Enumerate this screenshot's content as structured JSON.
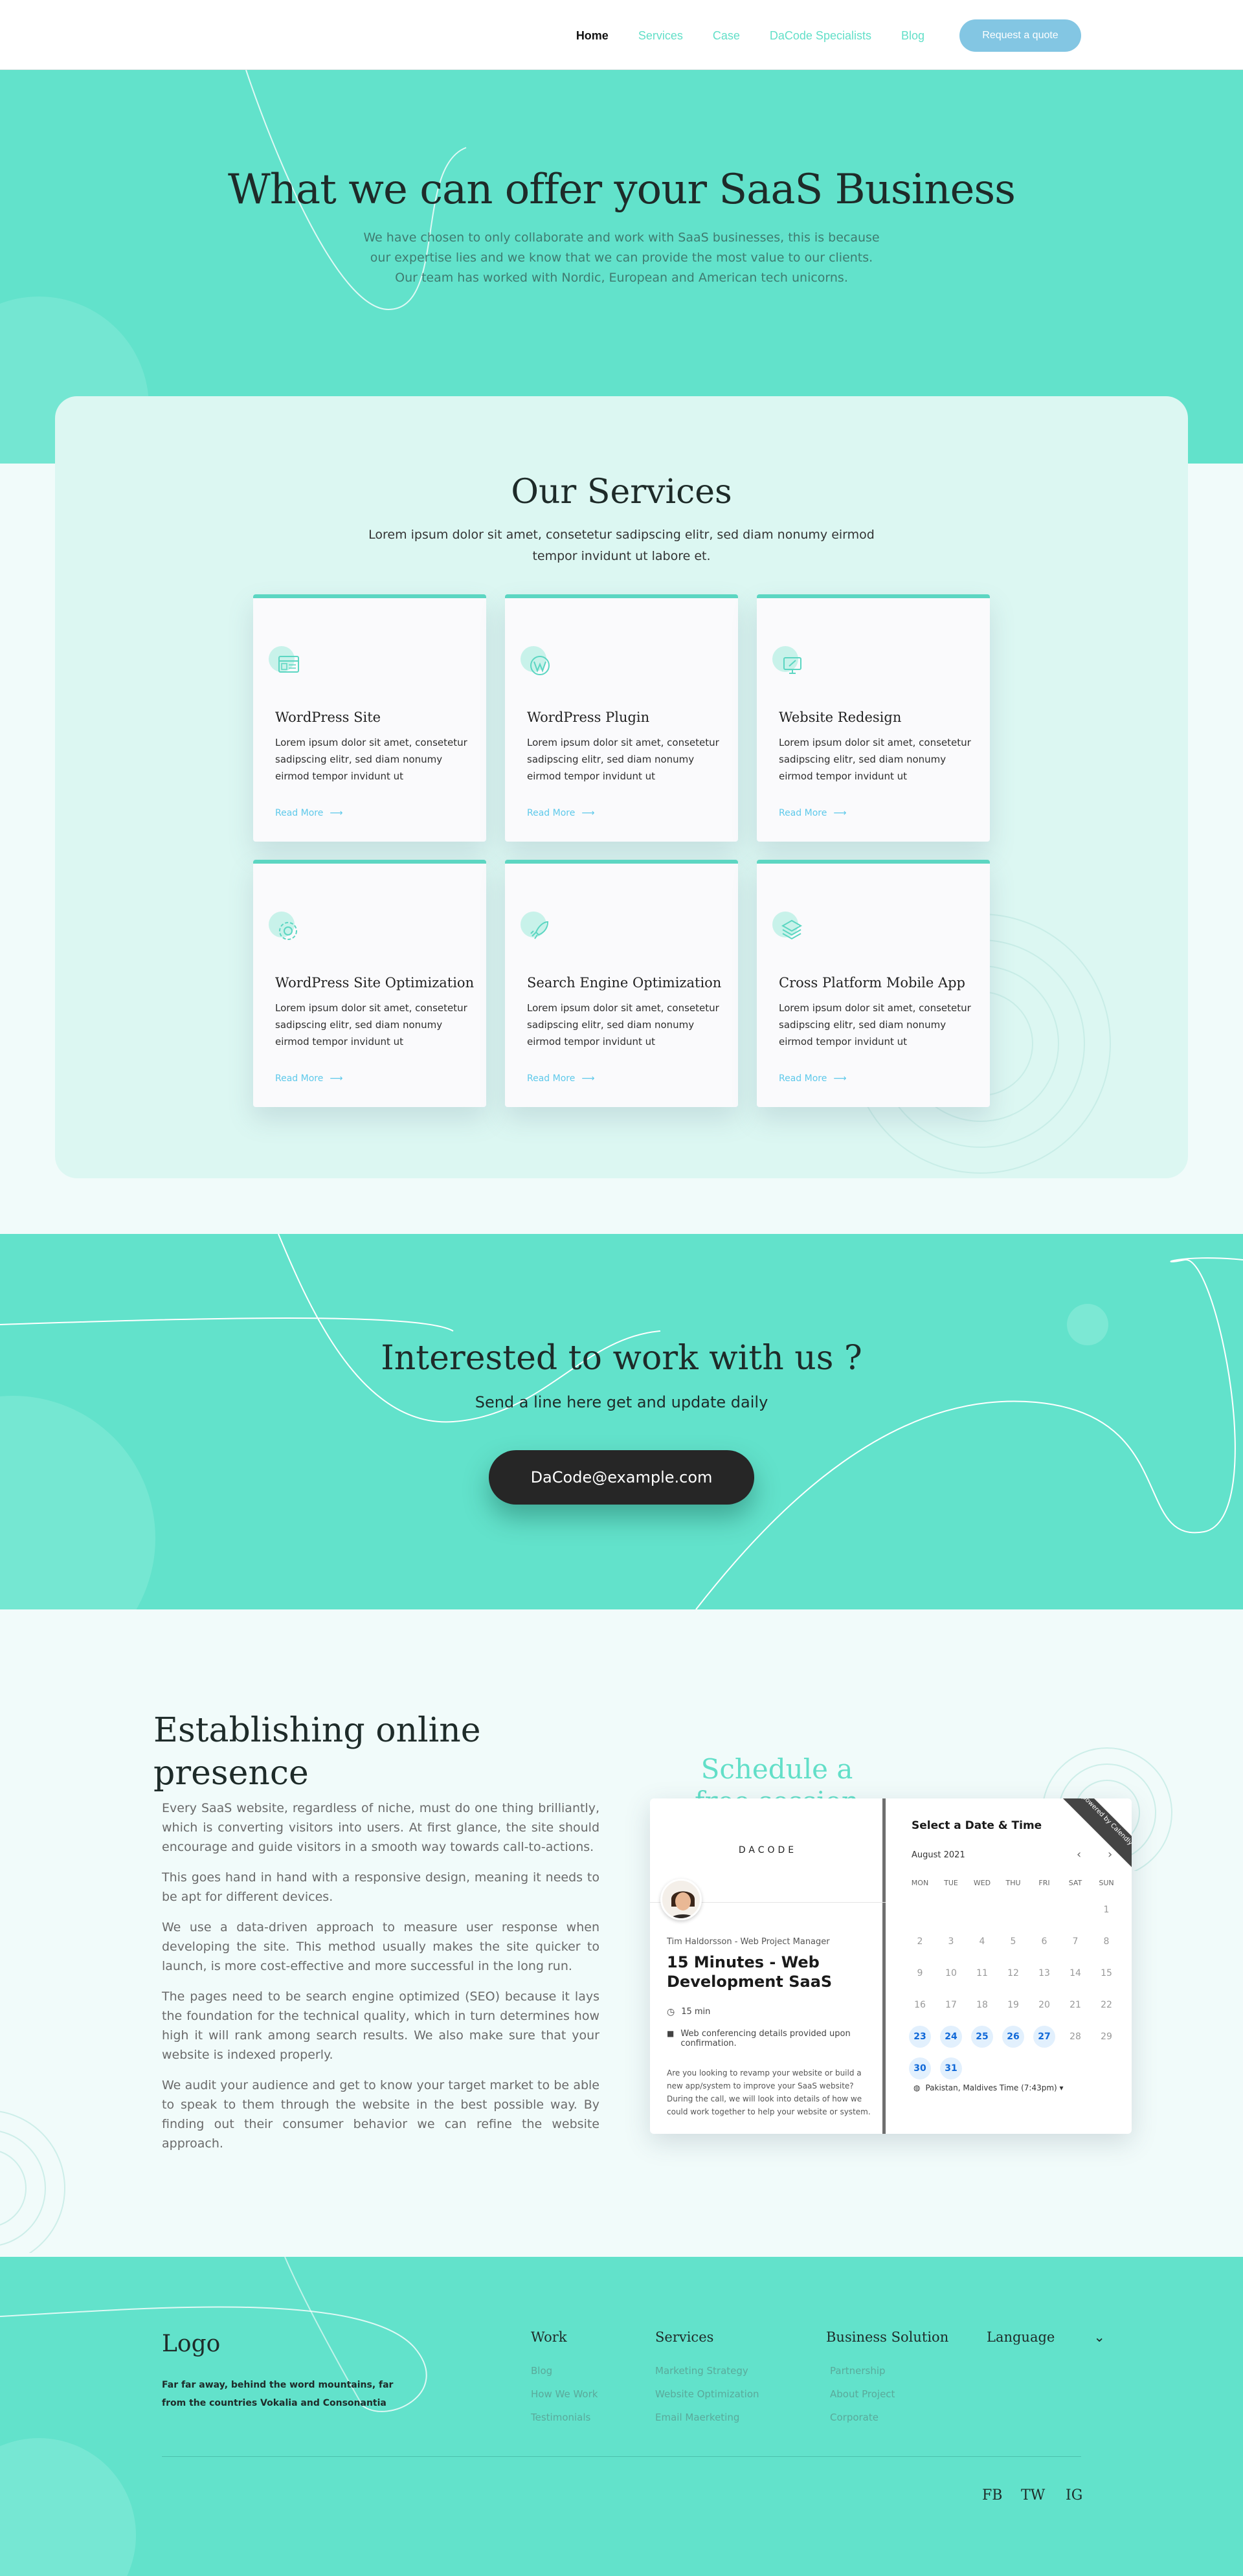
{
  "nav": {
    "items": [
      {
        "label": "Home",
        "active": true
      },
      {
        "label": "Services"
      },
      {
        "label": "Case"
      },
      {
        "label": "DaCode Specialists"
      },
      {
        "label": "Blog"
      }
    ],
    "cta_label": "Request a quote"
  },
  "hero": {
    "title": "What we can offer your SaaS Business",
    "subtitle": "We have chosen to only collaborate and work with SaaS businesses, this is because our expertise lies and we know that we can provide the most value to our clients. Our team has worked with Nordic, European and American tech unicorns."
  },
  "services": {
    "title": "Our Services",
    "subtitle": "Lorem ipsum dolor sit amet, consetetur sadipscing elitr, sed diam nonumy eirmod tempor invidunt ut labore et.",
    "cards": [
      {
        "title": "WordPress Site",
        "icon": "website-icon",
        "text": "Lorem ipsum dolor sit amet, consetetur sadipscing elitr, sed diam nonumy eirmod tempor invidunt ut",
        "link": "Read More"
      },
      {
        "title": "WordPress Plugin",
        "icon": "wordpress-icon",
        "text": "Lorem ipsum dolor sit amet, consetetur sadipscing elitr, sed diam nonumy eirmod tempor invidunt ut",
        "link": "Read More"
      },
      {
        "title": "Website Redesign",
        "icon": "redesign-icon",
        "text": "Lorem ipsum dolor sit amet, consetetur sadipscing elitr, sed diam nonumy eirmod tempor invidunt ut",
        "link": "Read More"
      },
      {
        "title": "WordPress Site Optimization",
        "icon": "gear-icon",
        "text": "Lorem ipsum dolor sit amet, consetetur sadipscing elitr, sed diam nonumy eirmod tempor invidunt ut",
        "link": "Read More"
      },
      {
        "title": "Search Engine Optimization",
        "icon": "rocket-icon",
        "text": "Lorem ipsum dolor sit amet, consetetur sadipscing elitr, sed diam nonumy eirmod tempor invidunt ut",
        "link": "Read More"
      },
      {
        "title": "Cross Platform Mobile App",
        "icon": "layers-icon",
        "text": "Lorem ipsum dolor sit amet, consetetur sadipscing elitr, sed diam nonumy eirmod tempor invidunt ut",
        "link": "Read More"
      }
    ]
  },
  "cta": {
    "title": "Interested to work with us ?",
    "subtitle": "Send a line here get and update daily",
    "email": "DaCode@example.com"
  },
  "presence": {
    "title": "Establishing online presence",
    "paragraphs": [
      "Every SaaS website, regardless of niche, must do one thing brilliantly, which is converting visitors into users. At first glance, the site should encourage and guide visitors in a smooth way towards call-to-actions.",
      "This goes hand in hand with a responsive design, meaning it needs to be apt for different devices.",
      "We use a data-driven approach to measure user response when developing the site. This method usually makes the site quicker to launch, is more cost-effective and more successful in the long run.",
      "The pages need to be search engine optimized (SEO) because it lays the foundation for the technical quality, which in turn determines how high it will rank among search results. We also make sure that your website is indexed properly.",
      "We audit your audience and get to know your target market to be able to speak to them through the website in the best possible way. By finding out their consumer behavior we can refine the website approach."
    ]
  },
  "schedule": {
    "title": "Schedule a free session",
    "brand": "DACODE",
    "person": "Tim Haldorsson - Web Project Manager",
    "event": "15 Minutes - Web Development SaaS",
    "duration": "15 min",
    "conferencing": "Web conferencing details provided upon confirmation.",
    "description": "Are you looking to revamp your website or build a new app/system to improve your SaaS website? During the call, we will look into details of how we could work together to help your website or system.",
    "ribbon": "powered by Calendly",
    "calendar": {
      "title": "Select a Date & Time",
      "month": "August 2021",
      "dows": [
        "MON",
        "TUE",
        "WED",
        "THU",
        "FRI",
        "SAT",
        "SUN"
      ],
      "days": [
        "1",
        "2",
        "3",
        "4",
        "5",
        "6",
        "7",
        "8",
        "9",
        "10",
        "11",
        "12",
        "13",
        "14",
        "15",
        "16",
        "17",
        "18",
        "19",
        "20",
        "21",
        "22",
        "23",
        "24",
        "25",
        "26",
        "27",
        "28",
        "29",
        "30",
        "31"
      ],
      "available": [
        "23",
        "24",
        "25",
        "26",
        "27",
        "30",
        "31"
      ],
      "timezone": "Pakistan, Maldives Time (7:43pm) ▾"
    }
  },
  "footer": {
    "logo": "Logo",
    "tagline": "Far far away, behind the word mountains, far from the countries Vokalia and Consonantia",
    "columns": [
      {
        "title": "Work",
        "links": [
          "Blog",
          "How We Work",
          "Testimonials"
        ]
      },
      {
        "title": "Services",
        "links": [
          "Marketing Strategy",
          "Website Optimization",
          "Email Maerketing"
        ]
      },
      {
        "title": "Business Solution",
        "links": [
          "Partnership",
          "About Project",
          "Corporate"
        ]
      }
    ],
    "language": "Language",
    "social": [
      "FB",
      "TW",
      "IG"
    ]
  },
  "colors": {
    "accent": "#62e2cb",
    "panel": "#dcf7f2",
    "button_dark": "#262626",
    "quote_button": "#83c6e3",
    "link": "#5ec9ea"
  }
}
